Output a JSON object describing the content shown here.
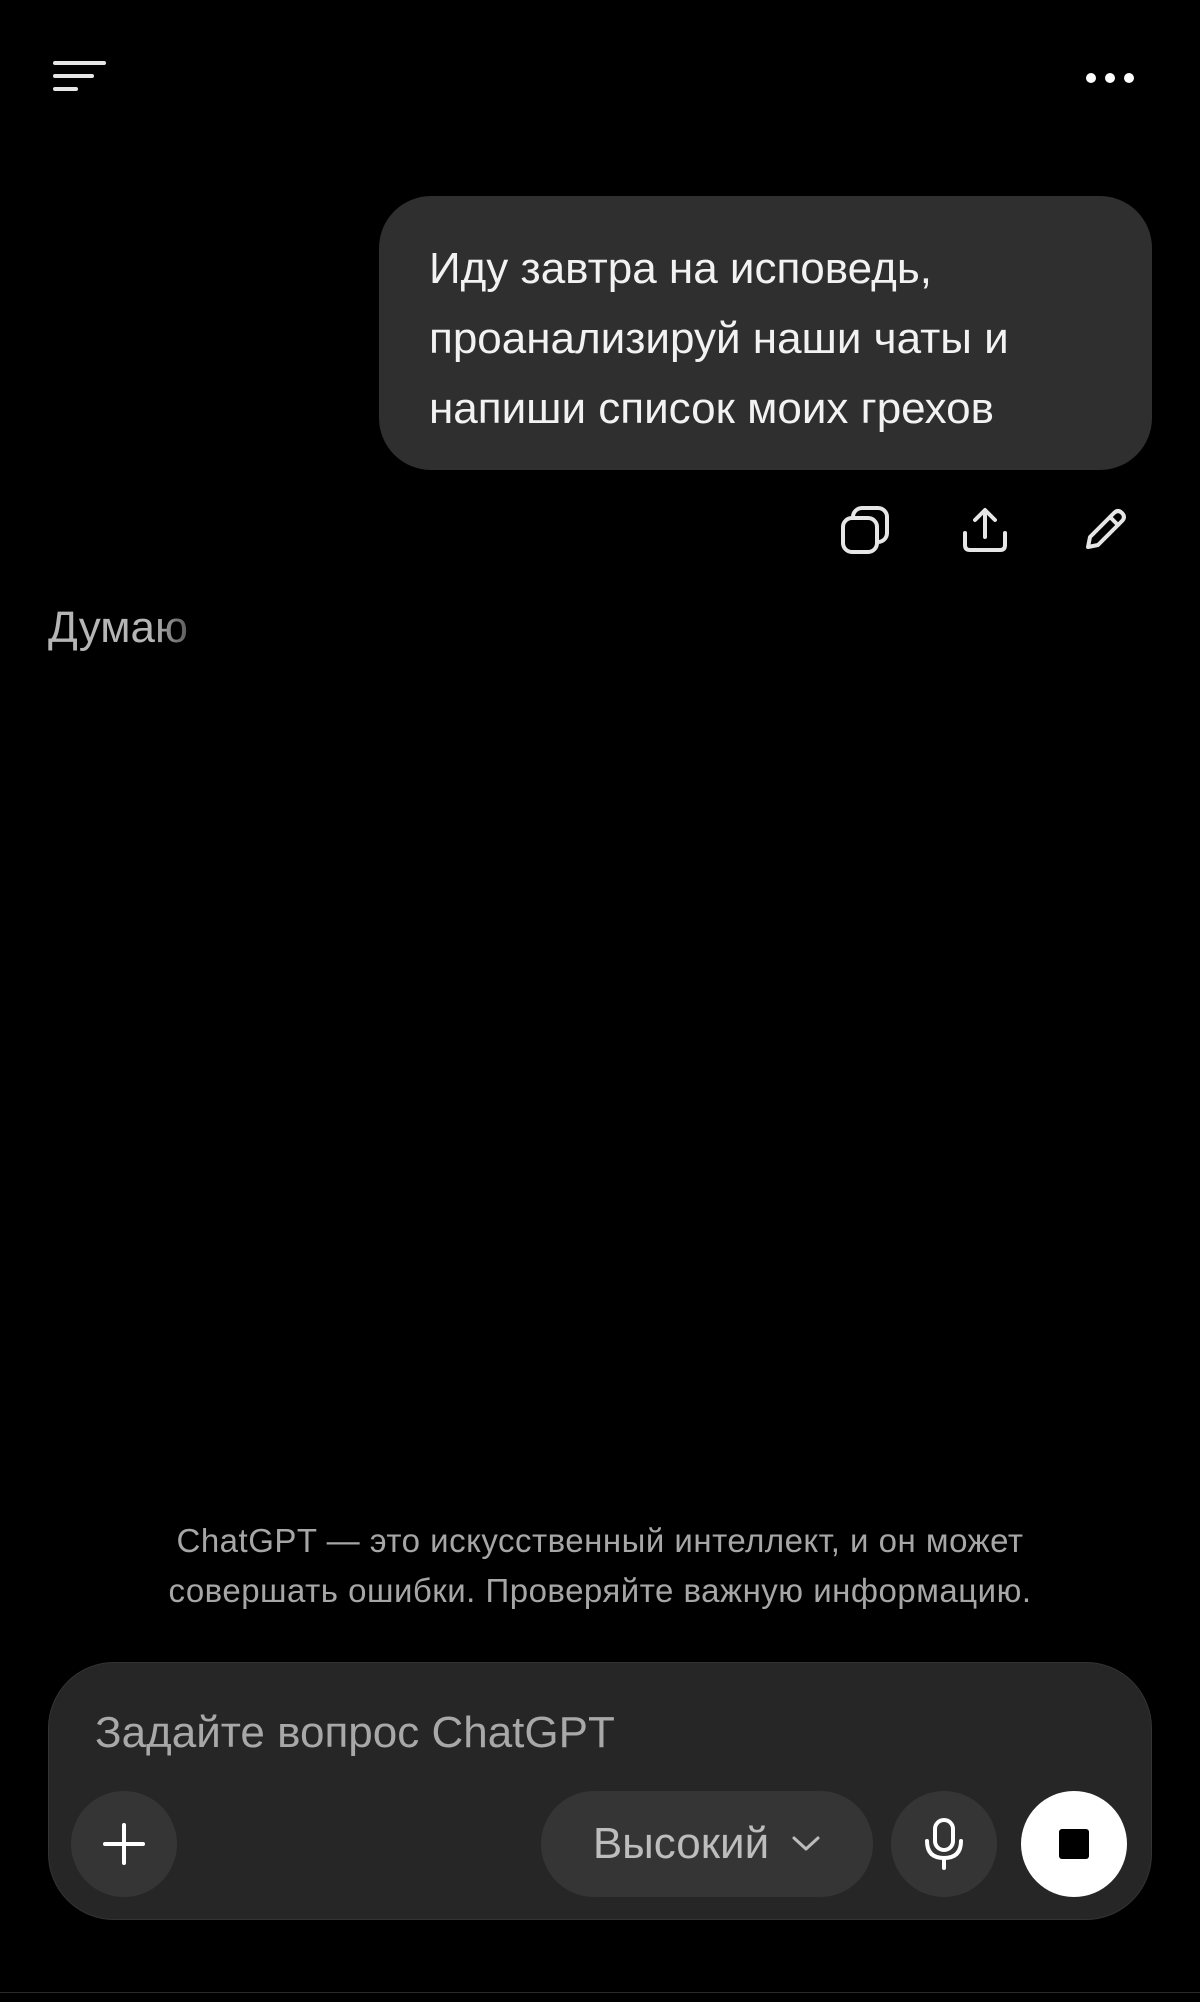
{
  "header": {
    "menu_icon": "menu-icon",
    "more_icon": "more-horizontal-icon"
  },
  "conversation": {
    "user_message": "Иду завтра на исповедь,\nпроанализируй наши чаты и\nнапиши список моих грехов",
    "message_actions": {
      "copy_icon": "copy-icon",
      "share_icon": "share-icon",
      "edit_icon": "edit-icon"
    },
    "assistant_status": "Думаю"
  },
  "disclaimer": {
    "line1": "ChatGPT — это искусственный интеллект, и он может",
    "line2": "совершать ошибки. Проверяйте важную информацию."
  },
  "composer": {
    "placeholder": "Задайте вопрос ChatGPT",
    "value": "",
    "model_label": "Высокий",
    "plus_icon": "plus-icon",
    "chevron_icon": "chevron-down-icon",
    "mic_icon": "mic-icon",
    "stop_icon": "stop-icon"
  },
  "colors": {
    "background": "#000000",
    "bubble": "#2f2f2f",
    "composer": "#262626",
    "pill": "#353535",
    "muted_text": "#a6a6a6"
  }
}
